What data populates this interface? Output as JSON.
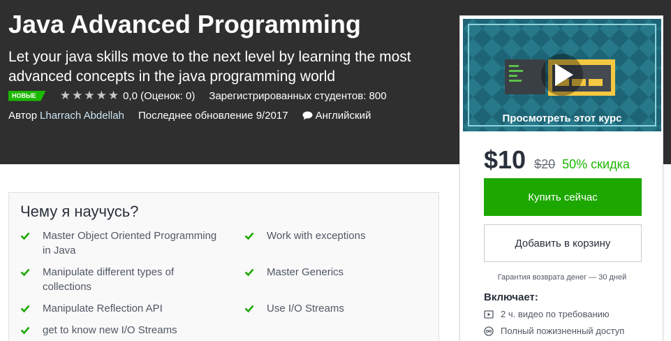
{
  "course": {
    "title": "Java Advanced Programming",
    "subtitle": "Let your java skills move to the next level by learning the most advanced concepts in the java programming world",
    "badge": "НОВЫЕ",
    "rating_value": 0,
    "rating_text": "0,0 (Оценок: 0)",
    "students_text": "Зарегистрированных студентов: 800",
    "author_prefix": "Автор",
    "author_name": "Lharrach Abdellah",
    "updated_text": "Последнее обновление 9/2017",
    "language": "Английский"
  },
  "learn": {
    "heading": "Чему я научусь?",
    "objectives": [
      "Master Object Oriented Programming in Java",
      "Work with exceptions",
      "Manipulate different types of collections",
      "Master Generics",
      "Manipulate Reflection API",
      "Use I/O Streams",
      "get to know new I/O Streams"
    ]
  },
  "sidebar": {
    "preview_label": "Просмотреть этот курс",
    "price": "$10",
    "old_price": "$20",
    "discount": "50% скидка",
    "buy_label": "Купить сейчас",
    "cart_label": "Добавить в корзину",
    "guarantee": "Гарантия возврата денег — 30 дней",
    "includes_heading": "Включает:",
    "includes": [
      {
        "icon": "video-icon",
        "text": "2 ч. видео по требованию"
      },
      {
        "icon": "infinity-icon",
        "text": "Полный пожизненный доступ"
      }
    ]
  },
  "colors": {
    "hero_bg": "#2f2f2f",
    "accent_green": "#1ca800",
    "discount_green": "#1bb800",
    "author_link": "#cbe4f0"
  }
}
